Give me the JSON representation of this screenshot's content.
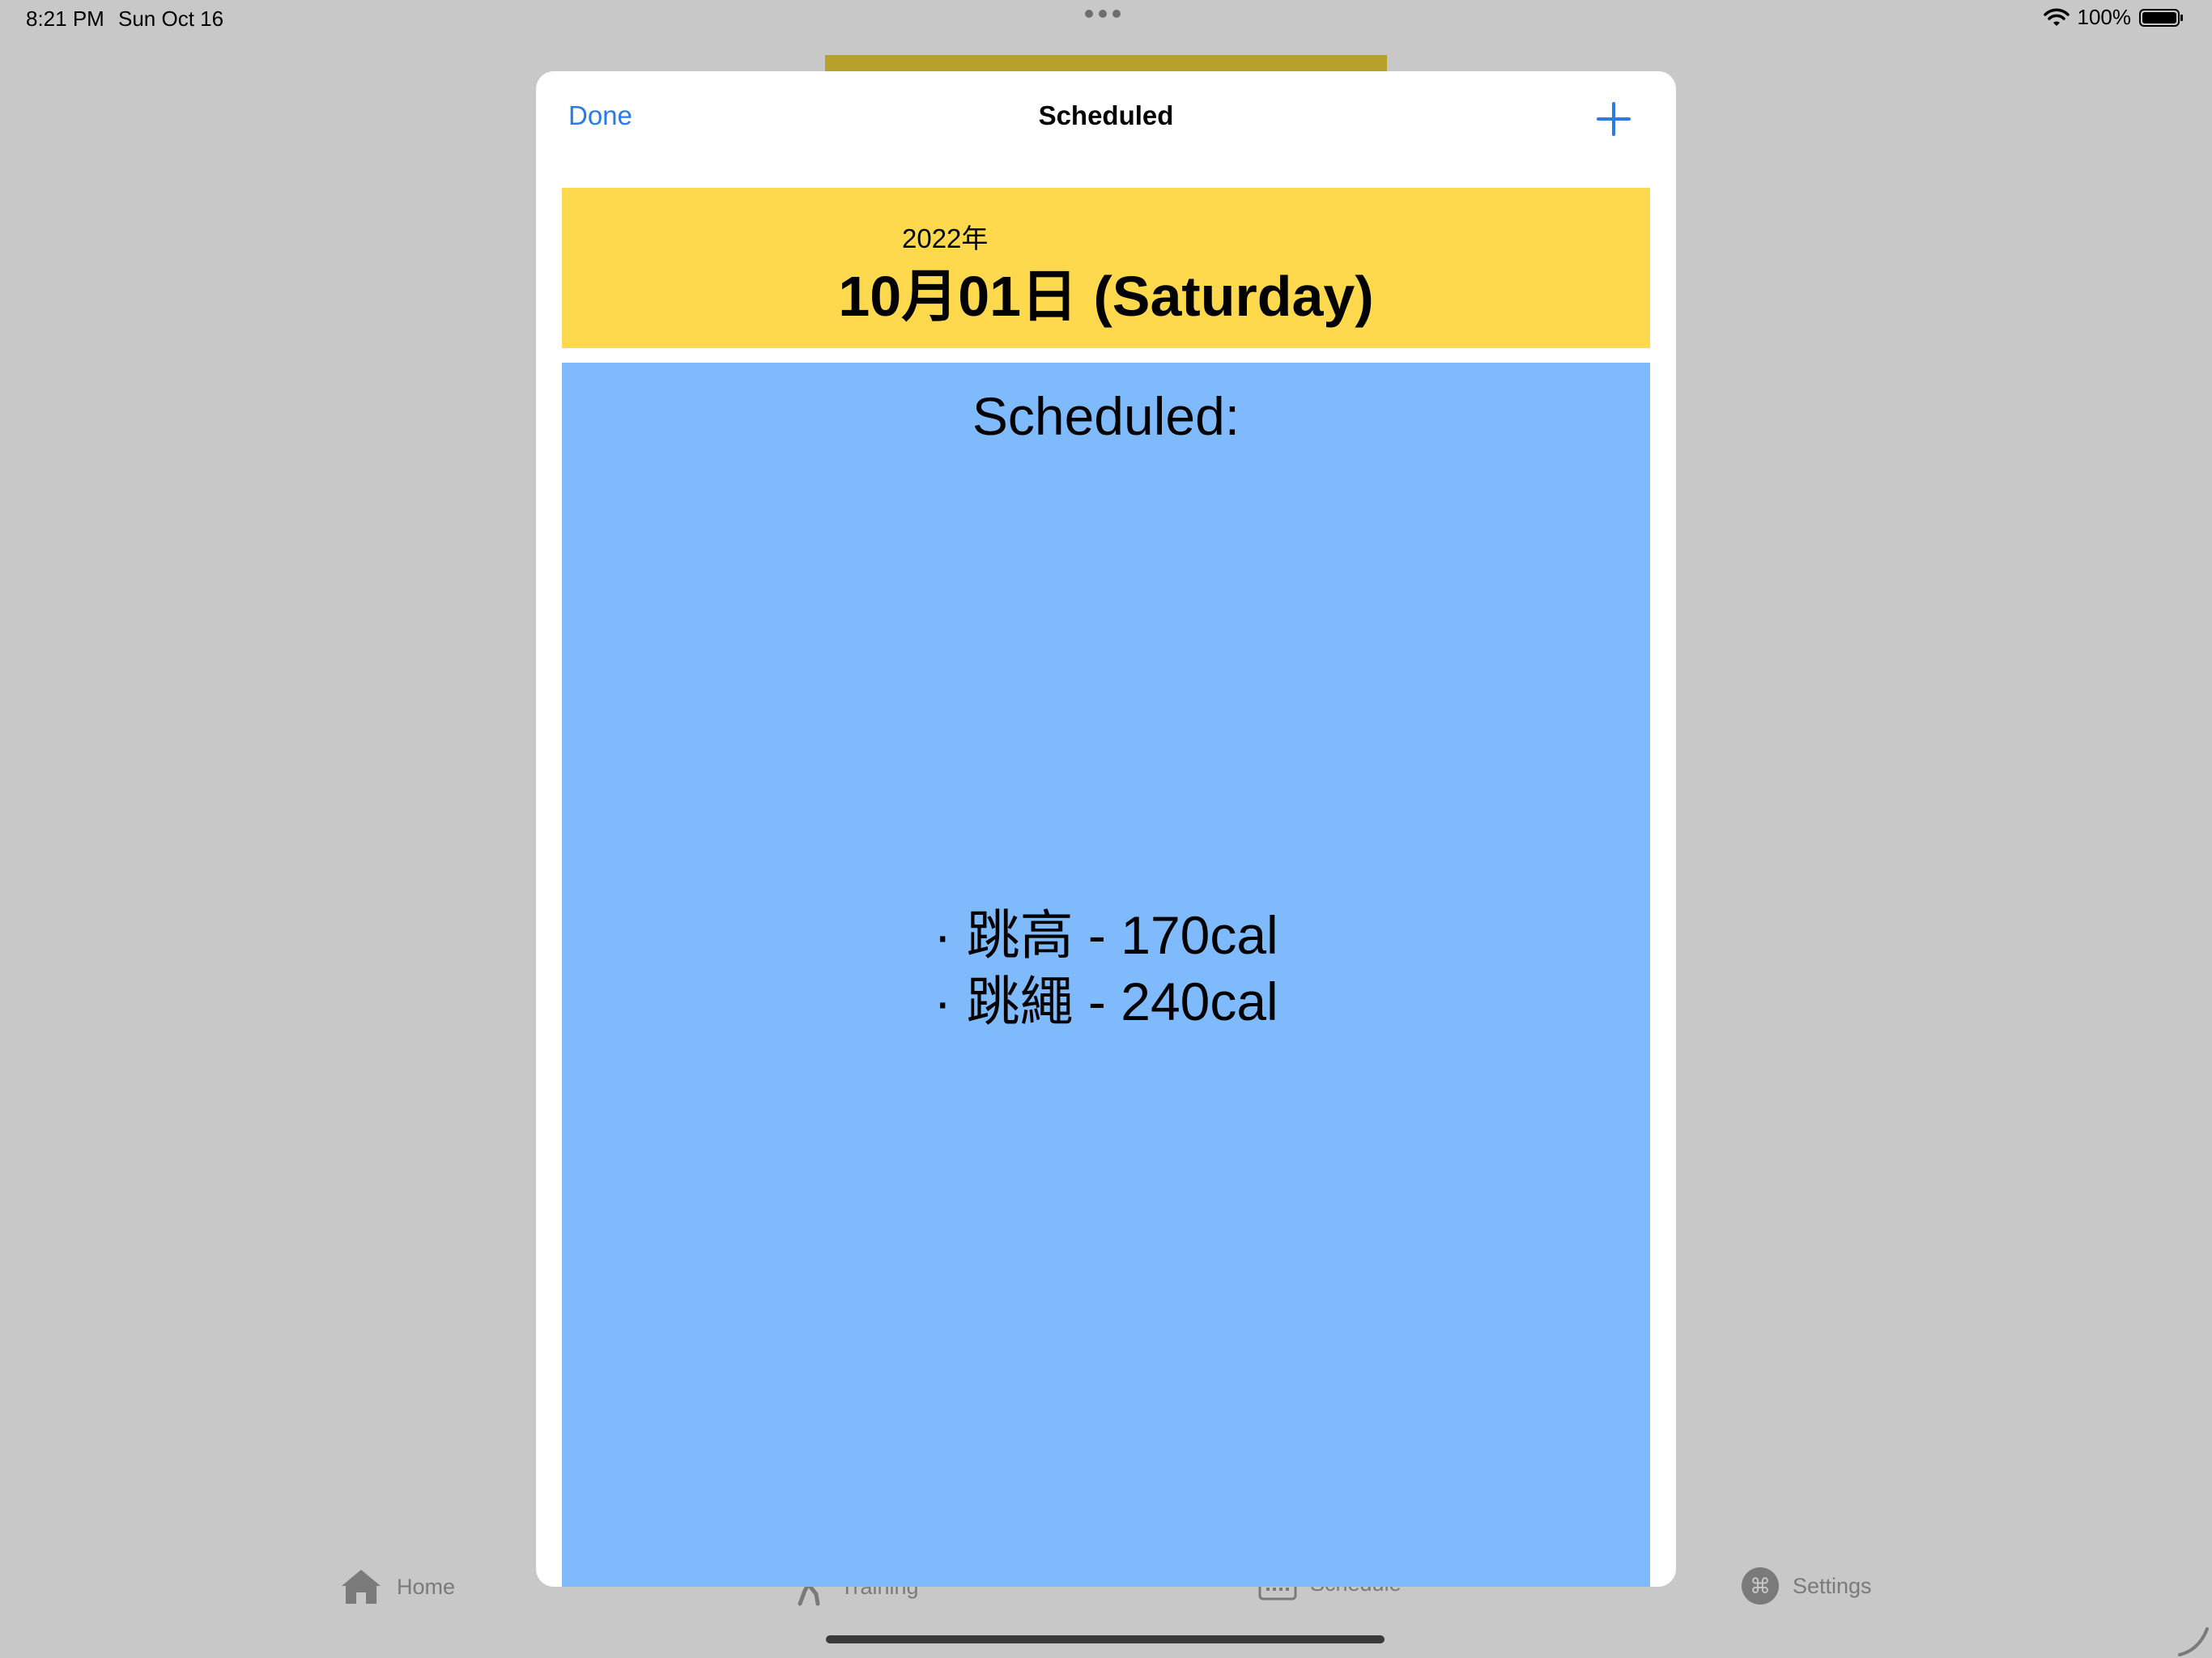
{
  "status_bar": {
    "time": "8:21 PM",
    "date": "Sun Oct 16",
    "battery": "100%"
  },
  "sheet": {
    "done_label": "Done",
    "title": "Scheduled",
    "add_icon": "plus-icon"
  },
  "date_card": {
    "year": "2022年",
    "date": "10月01日 (Saturday)"
  },
  "schedule": {
    "heading": "Scheduled:",
    "items": [
      "· 跳高 - 170cal",
      "· 跳繩 - 240cal"
    ]
  },
  "tab_bar": {
    "tabs": [
      {
        "label": "Home",
        "icon": "house-icon"
      },
      {
        "label": "Training",
        "icon": "figure-walk-icon"
      },
      {
        "label": "Schedule",
        "icon": "calendar-icon"
      },
      {
        "label": "Settings",
        "icon": "command-icon"
      }
    ]
  },
  "colors": {
    "accent": "#2a7be4",
    "date_card": "#fed94d",
    "schedule_card": "#7fbbfc",
    "dim_background": "#c8c8c8"
  }
}
